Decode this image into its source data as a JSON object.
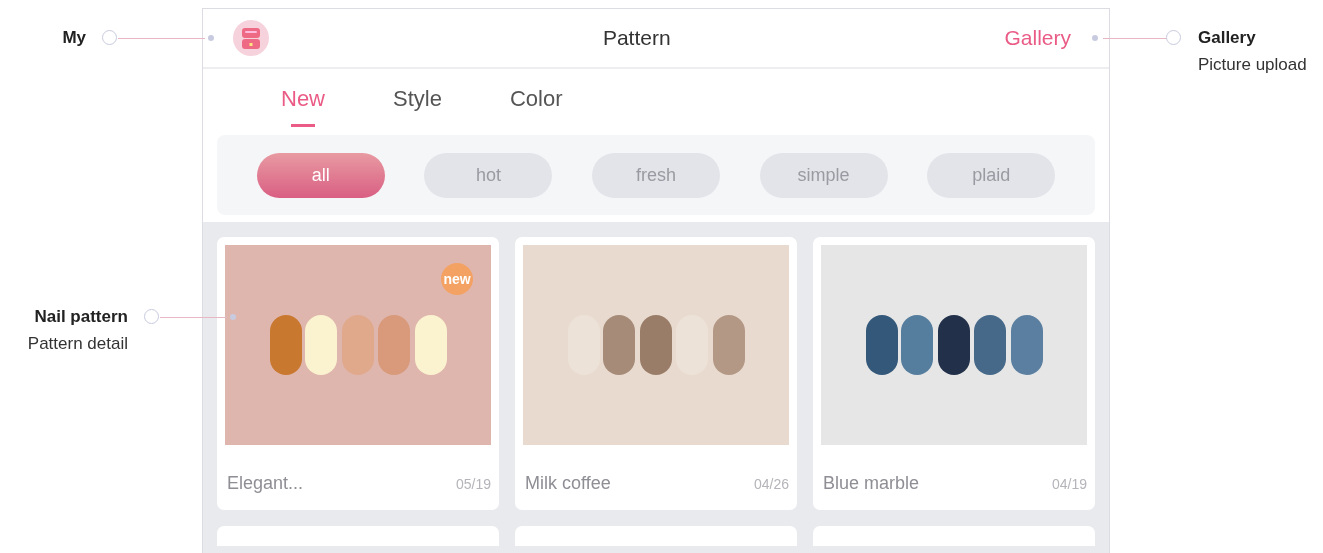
{
  "header": {
    "title": "Pattern",
    "action": "Gallery",
    "avatar_callout": {
      "title": "My"
    },
    "action_callout": {
      "title": "Gallery",
      "subtitle": "Picture upload"
    }
  },
  "tabs": [
    {
      "label": "New",
      "selected": true
    },
    {
      "label": "Style",
      "selected": false
    },
    {
      "label": "Color",
      "selected": false
    }
  ],
  "filters": [
    {
      "label": "all",
      "selected": true
    },
    {
      "label": "hot",
      "selected": false
    },
    {
      "label": "fresh",
      "selected": false
    },
    {
      "label": "simple",
      "selected": false
    },
    {
      "label": "plaid",
      "selected": false
    }
  ],
  "cards": [
    {
      "title": "Elegant...",
      "date": "05/19",
      "badge": "new",
      "callout": {
        "title": "Nail pattern",
        "subtitle": "Pattern detail"
      }
    },
    {
      "title": "Milk coffee",
      "date": "04/26"
    },
    {
      "title": "Blue marble",
      "date": "04/19"
    }
  ]
}
